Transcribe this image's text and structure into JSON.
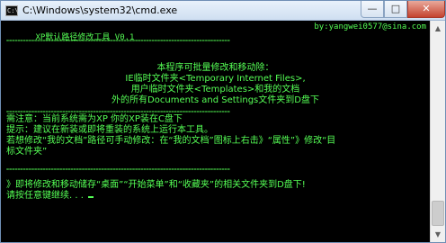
{
  "window": {
    "title": "C:\\Windows\\system32\\cmd.exe",
    "icon_text": "C:\\",
    "controls": {
      "minimize": "—",
      "maximize": "□",
      "close": "✕"
    }
  },
  "console": {
    "header_left": "XP默认路径修改工具 V0.1",
    "header_right": "by:yangwei0577@sina.com",
    "rule_1": "================================================================================",
    "intro": [
      "本程序可批量修改和移动除：",
      "IE临时文件夹<Temporary Internet Files>,",
      "用户临时文件夹<Templates>和我的文档",
      "外的所有Documents and Settings文件夹到D盘下"
    ],
    "rule_2": "================================================================================",
    "notes": [
      "需注意：当前系统需为XP 你的XP装在C盘下",
      "提示：建议在新装或即将重装的系统上运行本工具。",
      "若想修改“我的文档”路径可手动修改：在“我的文档”图标上右击》“属性”》修改“目",
      "标文件夹”"
    ],
    "rule_3": "================================================================================",
    "action": "》即将修改和移动储存“桌面”“开始菜单”和“收藏夹”的相关文件夹到D盘下!",
    "prompt": "请按任意键继续. . . "
  },
  "colors": {
    "console_text": "#55ff55",
    "console_bg": "#000000",
    "close_button": "#c4432f"
  },
  "icons": {
    "app": "cmd-icon",
    "scroll_up": "scroll-up-arrow-icon",
    "scroll_down": "scroll-down-arrow-icon"
  }
}
